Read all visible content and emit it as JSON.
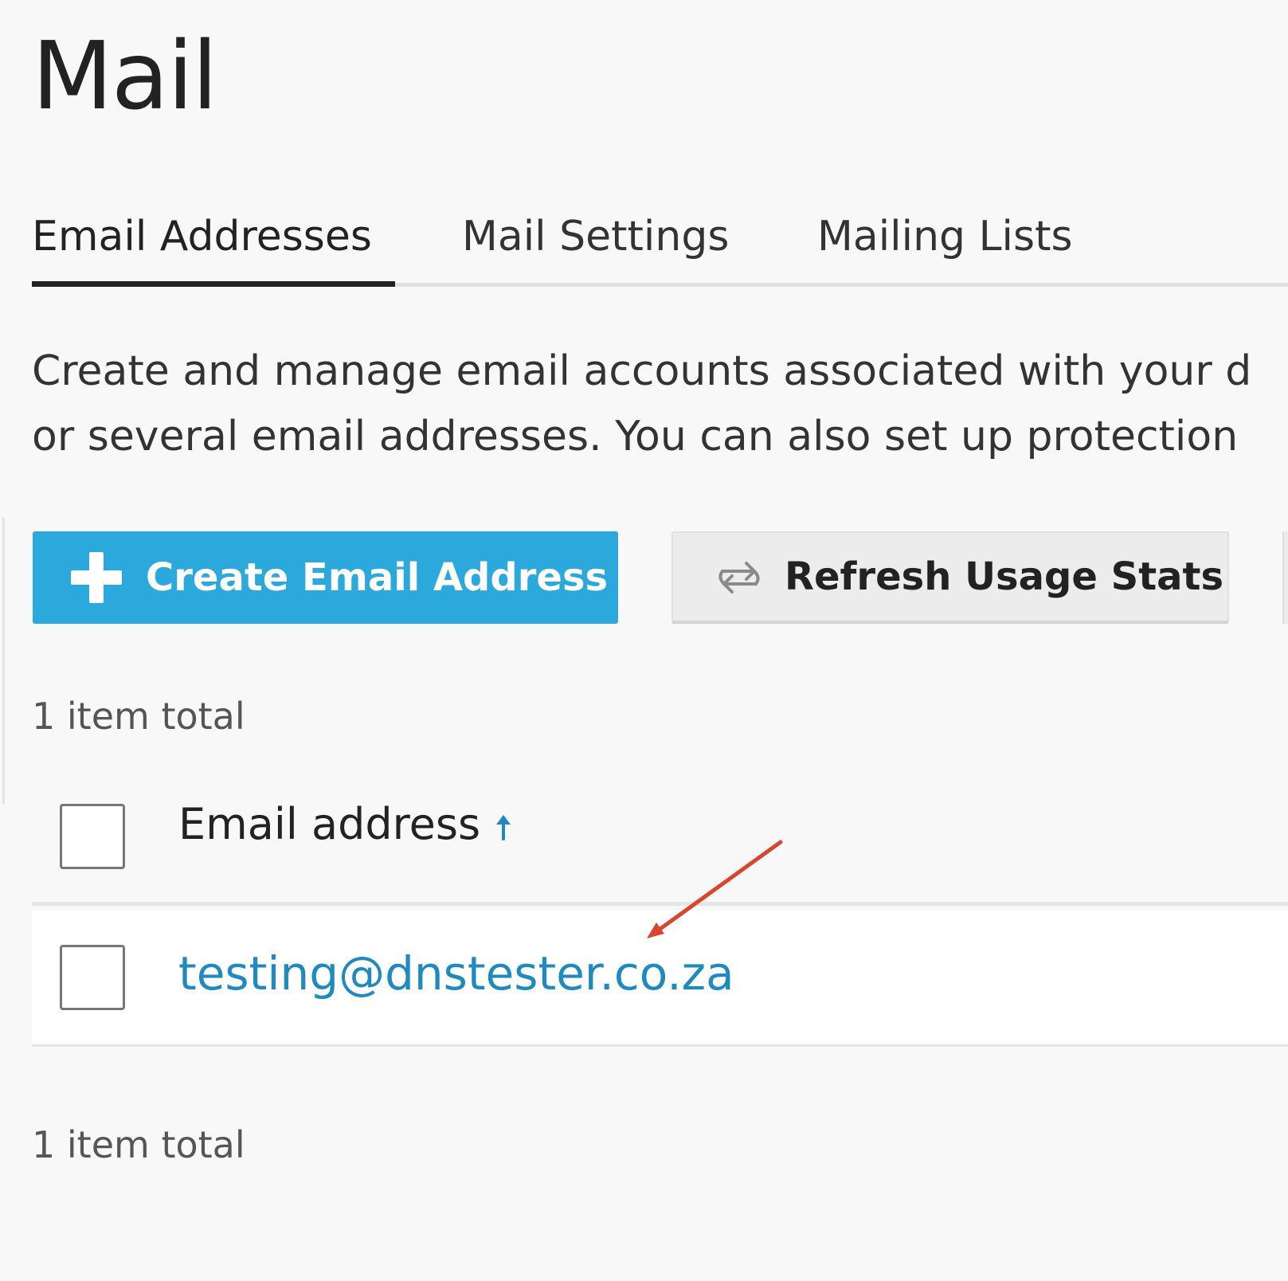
{
  "page": {
    "title": "Mail"
  },
  "tabs": [
    {
      "label": "Email Addresses",
      "active": true
    },
    {
      "label": "Mail Settings",
      "active": false
    },
    {
      "label": "Mailing Lists",
      "active": false
    }
  ],
  "description": {
    "line1": "Create and manage email accounts associated with your d",
    "line2": "or several email addresses. You can also set up protection"
  },
  "toolbar": {
    "create_label": "Create Email Address",
    "create_icon": "plus-icon",
    "refresh_label": "Refresh Usage Stats",
    "refresh_icon": "refresh-icon"
  },
  "list": {
    "count_top": "1 item total",
    "count_bottom": "1 item total",
    "columns": [
      {
        "label": "Email address",
        "sort": "ascending"
      }
    ],
    "rows": [
      {
        "email": "testing@dnstester.co.za"
      }
    ]
  },
  "colors": {
    "accent": "#2ba8dc",
    "link": "#1f8ac0",
    "annotation": "#d9452f"
  }
}
